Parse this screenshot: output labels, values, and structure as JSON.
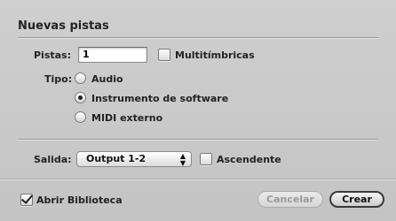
{
  "dialog": {
    "title": "Nuevas pistas",
    "tracks_label": "Pistas:",
    "tracks_value": "1",
    "multitimbral_label": "Multitímbricas",
    "multitimbral_checked": false,
    "type_label": "Tipo:",
    "types": [
      {
        "label": "Audio",
        "selected": false
      },
      {
        "label": "Instrumento de software",
        "selected": true
      },
      {
        "label": "MIDI externo",
        "selected": false
      }
    ],
    "output_label": "Salida:",
    "output_value": "Output 1-2",
    "ascending_label": "Ascendente",
    "ascending_checked": false,
    "open_library_label": "Abrir Biblioteca",
    "open_library_checked": true,
    "cancel_label": "Cancelar",
    "create_label": "Crear"
  }
}
